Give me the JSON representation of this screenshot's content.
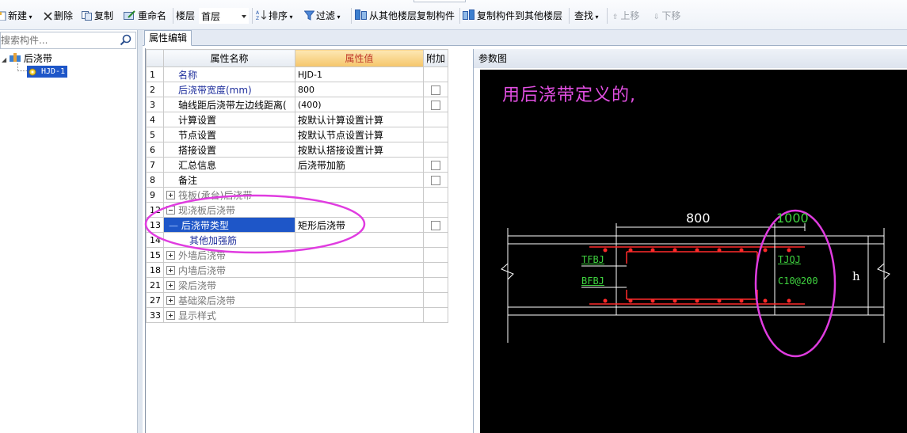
{
  "toolbar": {
    "new": "新建",
    "delete": "删除",
    "copy": "复制",
    "rename": "重命名",
    "floor_label": "楼层",
    "floor_value": "首层",
    "sort": "排序",
    "filter": "过滤",
    "copy_from_other": "从其他楼层复制构件",
    "copy_to_other": "复制构件到其他楼层",
    "find": "查找",
    "move_up": "上移",
    "move_down": "下移"
  },
  "search": {
    "placeholder": "搜索构件..."
  },
  "tree": {
    "root": "后浇带",
    "child": "HJD-1"
  },
  "tabs": {
    "attr": "属性编辑"
  },
  "grid": {
    "headers": {
      "name": "属性名称",
      "value": "属性值",
      "extra": "附加"
    },
    "rows": [
      {
        "num": "1",
        "name": "名称",
        "value": "HJD-1",
        "checkbox": false
      },
      {
        "num": "2",
        "name": "后浇带宽度(mm)",
        "value": "800",
        "checkbox": true
      },
      {
        "num": "3",
        "name": "轴线距后浇带左边线距离(",
        "value": "(400)",
        "checkbox": true
      },
      {
        "num": "4",
        "name": "计算设置",
        "value": "按默认计算设置计算",
        "checkbox": false
      },
      {
        "num": "5",
        "name": "节点设置",
        "value": "按默认节点设置计算",
        "checkbox": false
      },
      {
        "num": "6",
        "name": "搭接设置",
        "value": "按默认搭接设置计算",
        "checkbox": false
      },
      {
        "num": "7",
        "name": "汇总信息",
        "value": "后浇带加筋",
        "checkbox": true
      },
      {
        "num": "8",
        "name": "备注",
        "value": "",
        "checkbox": true
      },
      {
        "num": "9",
        "name": "筏板(承台)后浇带",
        "value": "",
        "checkbox": false
      },
      {
        "num": "12",
        "name": "现浇板后浇带",
        "value": "",
        "checkbox": false
      },
      {
        "num": "13",
        "name": "后浇带类型",
        "value": "矩形后浇带",
        "checkbox": true
      },
      {
        "num": "14",
        "name": "其他加强筋",
        "value": "",
        "checkbox": false
      },
      {
        "num": "15",
        "name": "外墙后浇带",
        "value": "",
        "checkbox": false
      },
      {
        "num": "18",
        "name": "内墙后浇带",
        "value": "",
        "checkbox": false
      },
      {
        "num": "21",
        "name": "梁后浇带",
        "value": "",
        "checkbox": false
      },
      {
        "num": "27",
        "name": "基础梁后浇带",
        "value": "",
        "checkbox": false
      },
      {
        "num": "33",
        "name": "显示样式",
        "value": "",
        "checkbox": false
      }
    ]
  },
  "param": {
    "title": "参数图",
    "caption": "用后浇带定义的,",
    "dim_width": "800",
    "dim_extra": "1000",
    "label_tfbj": "TFBJ",
    "label_bfbj": "BFBJ",
    "label_tjqj": "TJQJ",
    "label_spacing": "C10@200",
    "label_h": "h",
    "colors": {
      "background": "#000000",
      "rebar": "#ff2a2a",
      "text_green": "#3fd23f",
      "annotation": "#e24fe2"
    }
  }
}
